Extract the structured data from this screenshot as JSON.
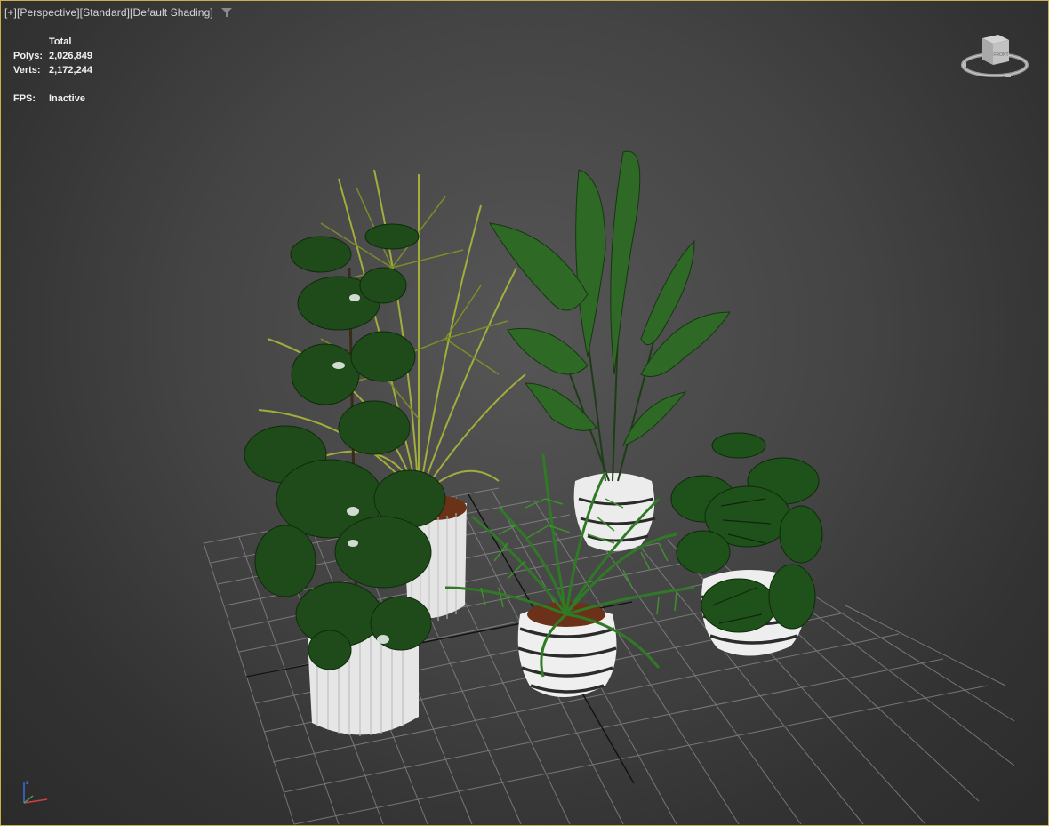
{
  "viewport": {
    "labels": [
      "[+]",
      "[Perspective]",
      "[Standard]",
      "[Default Shading]"
    ],
    "filter_icon": "filter-icon"
  },
  "stats": {
    "header": "Total",
    "polys_label": "Polys:",
    "polys_value": "2,026,849",
    "verts_label": "Verts:",
    "verts_value": "2,172,244",
    "fps_label": "FPS:",
    "fps_value": "Inactive"
  },
  "viewcube": {
    "face_label": "FRONT",
    "icon": "viewcube-icon"
  },
  "axis": {
    "icon": "axis-tripod-icon"
  },
  "colors": {
    "viewport_border": "#c9b04a",
    "grid": "#8a8a8a",
    "leaf_dark": "#1f4a1a",
    "leaf_mid": "#2f6b22",
    "leaf_yellow": "#9aa83a",
    "pot": "#e8e8e8"
  }
}
